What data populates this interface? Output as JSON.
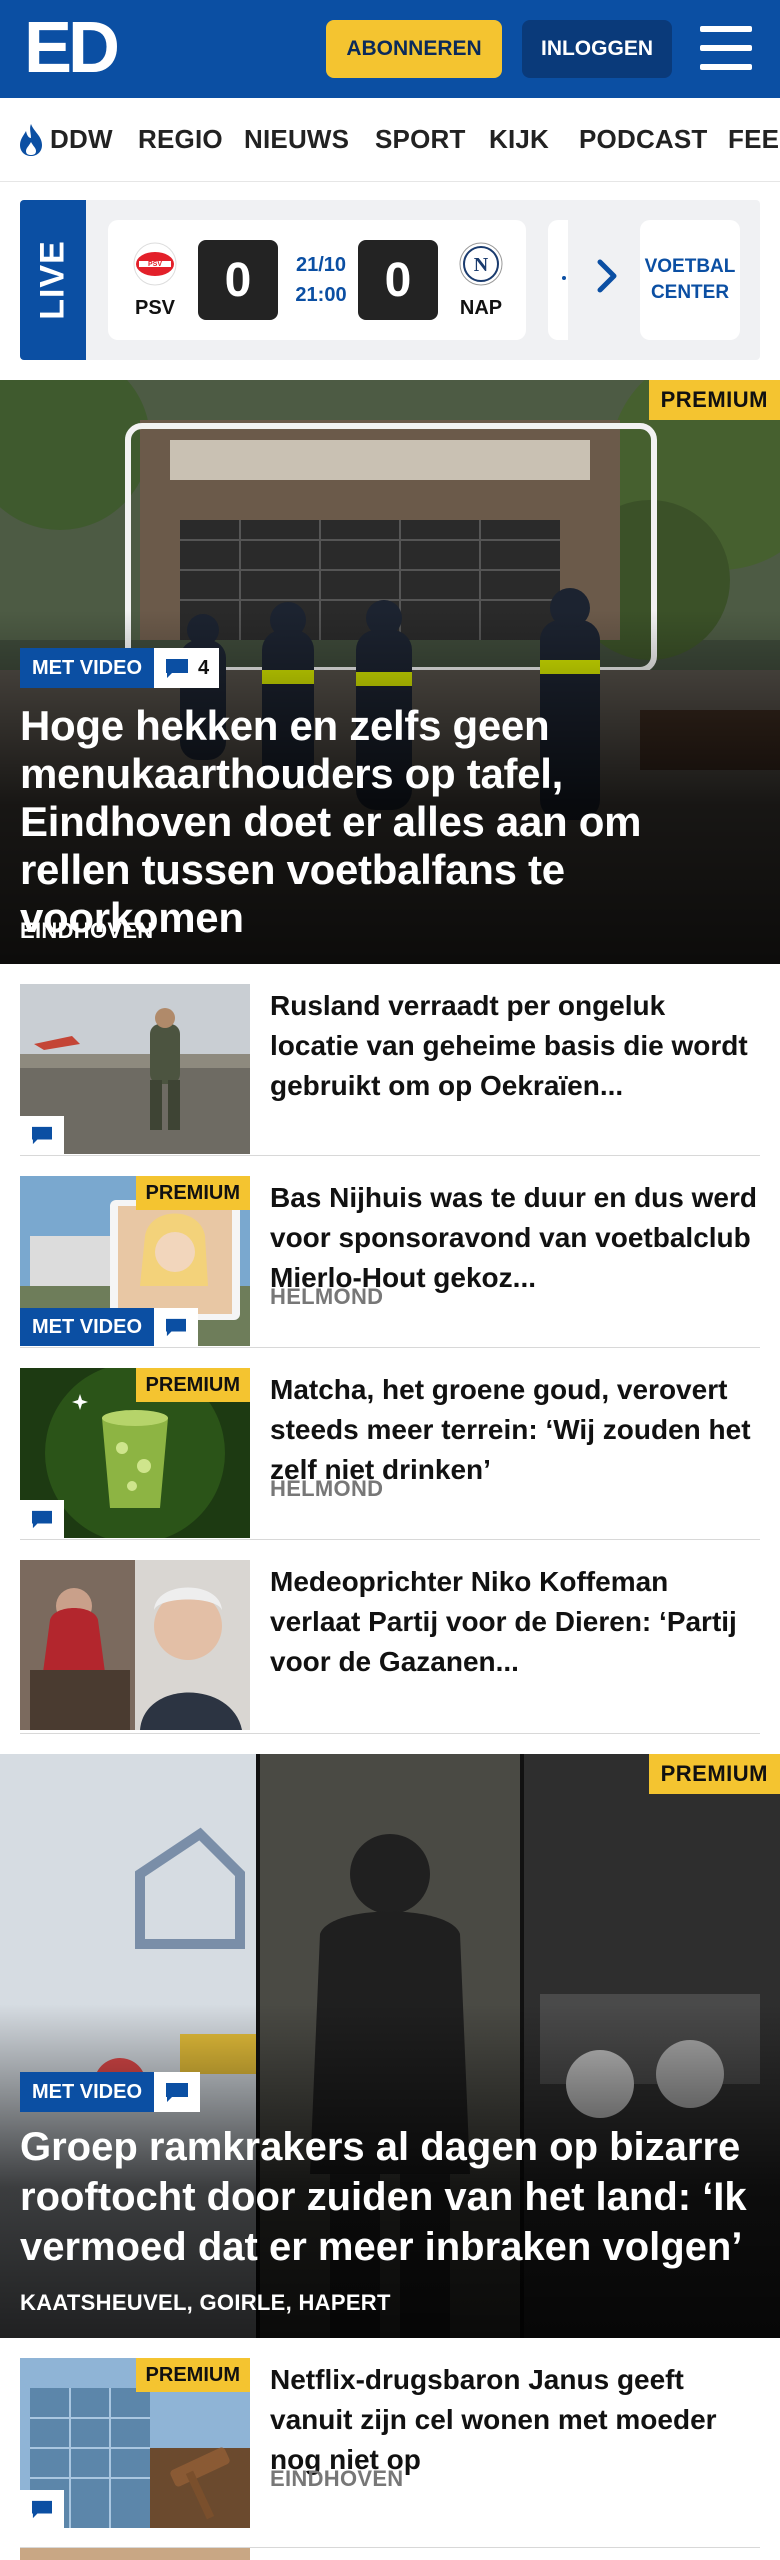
{
  "header": {
    "logo_text": "ED",
    "subscribe_label": "ABONNEREN",
    "login_label": "INLOGGEN",
    "menu_icon": "hamburger-icon"
  },
  "nav": {
    "items": [
      {
        "label": "DDW",
        "icon": "flame-icon"
      },
      {
        "label": "REGIO"
      },
      {
        "label": "NIEUWS"
      },
      {
        "label": "SPORT"
      },
      {
        "label": "KIJK"
      },
      {
        "label": "PODCAST"
      },
      {
        "label": "FEE"
      }
    ]
  },
  "live": {
    "label": "LIVE",
    "match": {
      "home": "PSV",
      "away": "NAP",
      "home_score": "0",
      "away_score": "0",
      "date": "21/10",
      "time": "21:00"
    },
    "voetbal_center": "VOETBAL CENTER",
    "next_icon": "chevron-right-icon"
  },
  "hero": {
    "premium": "PREMIUM",
    "video_badge": "MET VIDEO",
    "comment_count": "4",
    "title": "Hoge hekken en zelfs geen menukaarthouders op tafel, Eindhoven doet er alles aan om rellen tussen voetbalfans te voorkomen",
    "location": "EINDHOVEN"
  },
  "articles": [
    {
      "title": "Rusland verraadt per ongeluk locatie van geheime basis die wordt gebruikt om op Oekraïen...",
      "location": "",
      "premium": "",
      "video": ""
    },
    {
      "title": "Bas Nijhuis was te duur en dus werd voor sponsoravond van voetbalclub Mierlo-Hout gekoz...",
      "location": "HELMOND",
      "premium": "PREMIUM",
      "video": "MET VIDEO"
    },
    {
      "title": "Matcha, het groene goud, verovert steeds meer terrein: ‘Wij zouden het zelf niet drinken’",
      "location": "HELMOND",
      "premium": "PREMIUM",
      "video": ""
    },
    {
      "title": "Medeoprichter Niko Koffeman verlaat Partij voor de Dieren: ‘Partij voor de Gazanen...",
      "location": "",
      "premium": "",
      "video": ""
    }
  ],
  "hero2": {
    "premium": "PREMIUM",
    "video_badge": "MET VIDEO",
    "title": "Groep ramkrakers al dagen op bizarre rooftocht door zuiden van het land: ‘Ik vermoed dat er meer inbraken volgen’",
    "location": "KAATSHEUVEL, GOIRLE, HAPERT"
  },
  "article_last": {
    "title": "Netflix-drugsbaron Janus geeft vanuit zijn cel wonen met moeder nog niet op",
    "location": "EINDHOVEN",
    "premium": "PREMIUM"
  },
  "colors": {
    "brand_blue": "#0b4fa3",
    "premium_yellow": "#f4c430"
  }
}
